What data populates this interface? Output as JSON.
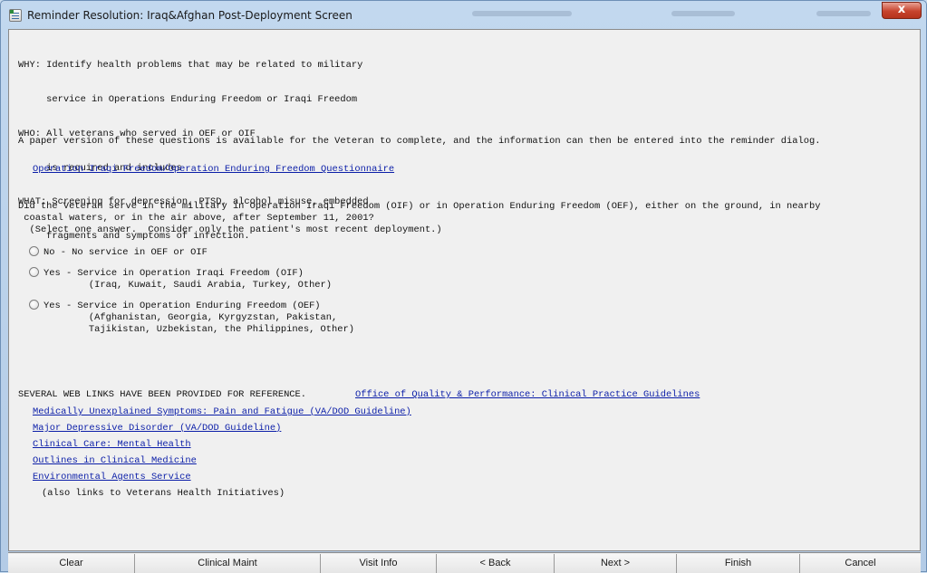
{
  "window": {
    "title": "Reminder Resolution: Iraq&Afghan Post-Deployment Screen",
    "close_glyph": "x"
  },
  "intro": {
    "lines": [
      "WHY: Identify health problems that may be related to military",
      "     service in Operations Enduring Freedom or Iraqi Freedom",
      "WHO: All veterans who served in OEF or OIF",
      "     is required and includes",
      "WHAT: Screening for depression, PTSD, alcohol misuse, embedded",
      "     fragments and symptoms of infection."
    ],
    "paper_note": "A paper version of these questions is available for the Veteran to complete, and the information can then be entered into the reminder dialog."
  },
  "questionnaire_link": "Operation Iraqi Freedom/Operation Enduring Freedom Questionnaire",
  "question": {
    "line1": "Did the Veteran serve in the military in Operation Iraqi Freedom (OIF) or in Operation Enduring Freedom (OEF), either on the ground, in nearby",
    "line2": " coastal waters, or in the air above, after September 11, 2001?",
    "line3": "  (Select one answer.  Consider only the patient's most recent deployment.)"
  },
  "options": [
    {
      "label": "No - No service in OEF or OIF",
      "detail": []
    },
    {
      "label": "Yes - Service in Operation Iraqi Freedom (OIF)",
      "detail": [
        "        (Iraq, Kuwait, Saudi Arabia, Turkey, Other)"
      ]
    },
    {
      "label": "Yes - Service in Operation Enduring Freedom (OEF)",
      "detail": [
        "        (Afghanistan, Georgia, Kyrgyzstan, Pakistan,",
        "        Tajikistan, Uzbekistan, the Philippines, Other)"
      ]
    }
  ],
  "weblinks": {
    "heading": "SEVERAL WEB LINKS HAVE BEEN PROVIDED FOR REFERENCE.",
    "quality_link": "Office of Quality & Performance: Clinical Practice Guidelines",
    "links": [
      "Medically Unexplained Symptoms: Pain and Fatigue (VA/DOD Guideline)",
      "Major Depressive Disorder (VA/DOD Guideline)",
      "Clinical Care: Mental Health",
      "Outlines in Clinical Medicine",
      "Environmental Agents Service"
    ],
    "footnote": "(also links to Veterans Health Initiatives)"
  },
  "buttons": {
    "clear": "Clear",
    "clinical_maint": "Clinical Maint",
    "visit_info": "Visit Info",
    "back": "< Back",
    "next": "Next >",
    "finish": "Finish",
    "cancel": "Cancel"
  }
}
